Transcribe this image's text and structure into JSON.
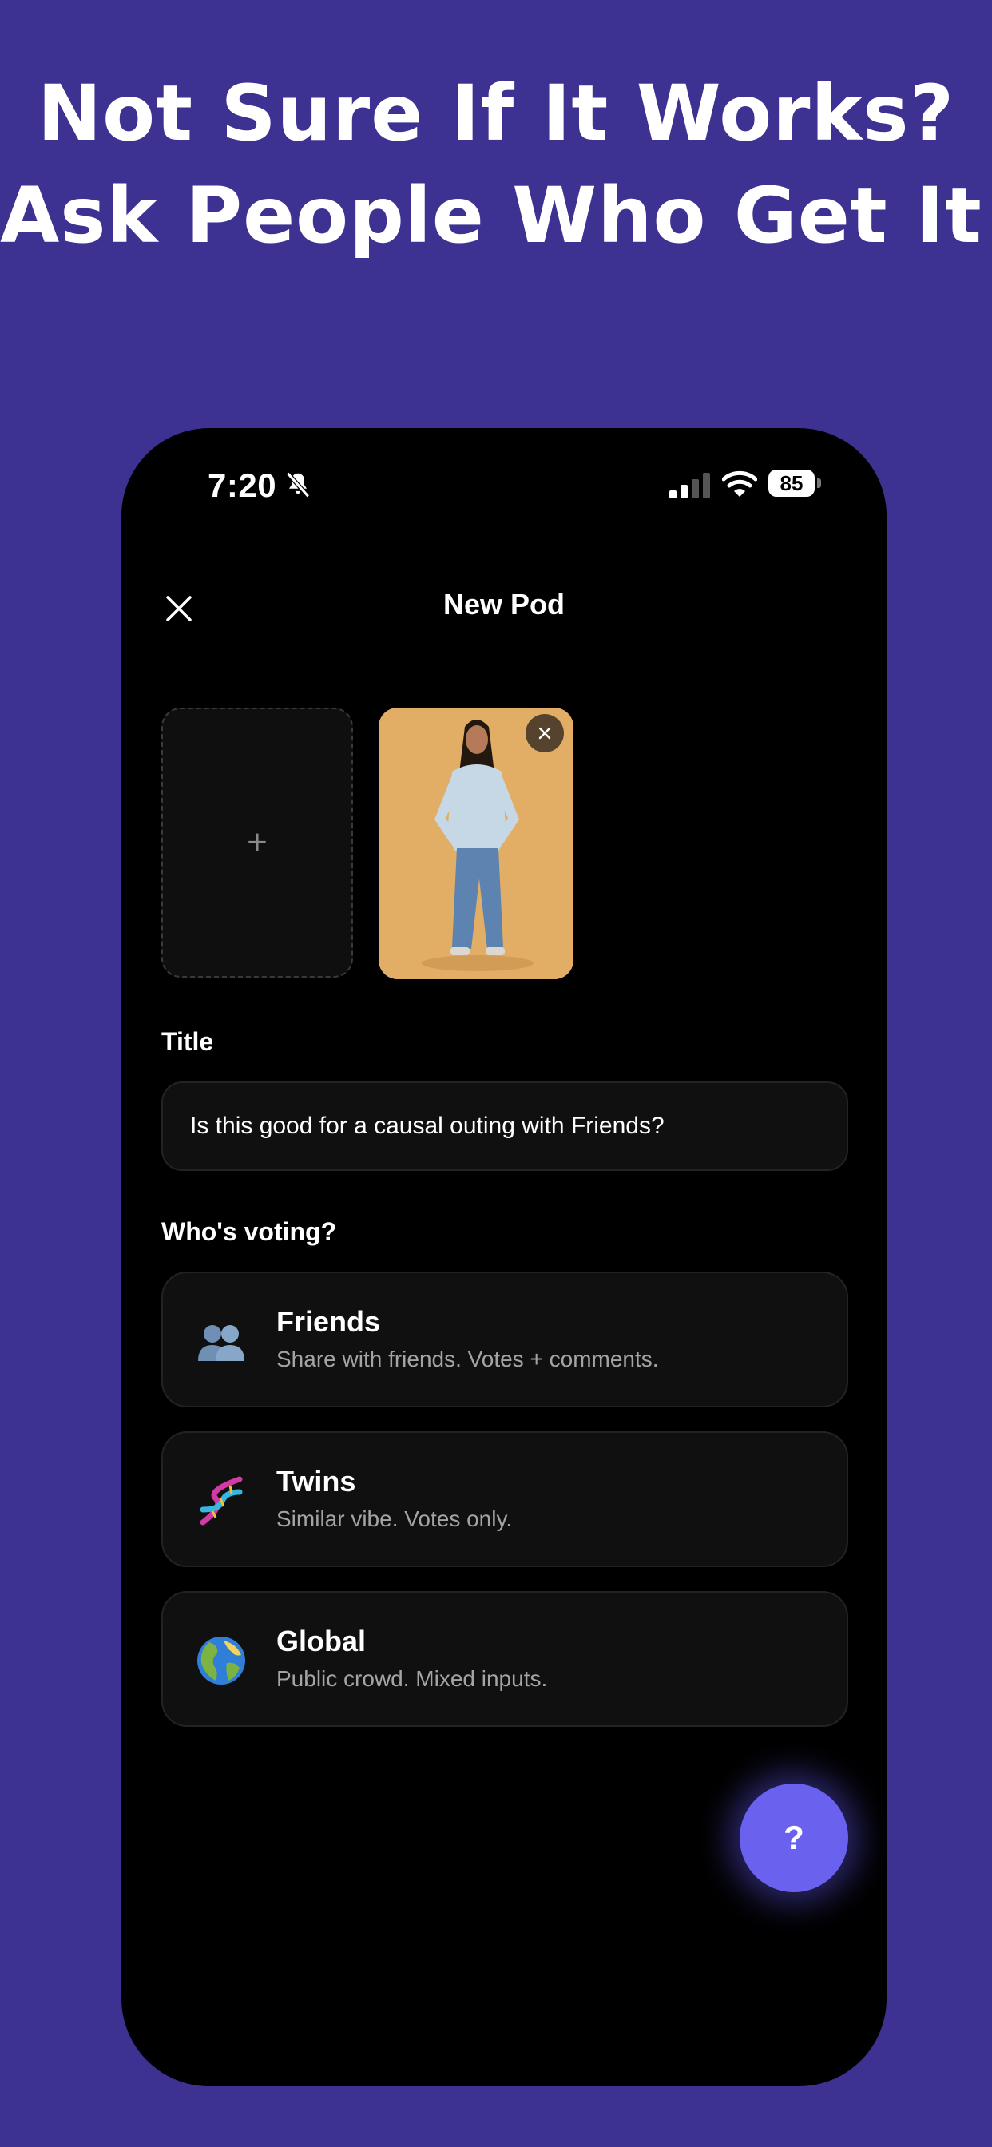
{
  "promo": {
    "headline_line1": "Not Sure If It Works?",
    "headline_line2": "Ask People Who Get It!"
  },
  "status_bar": {
    "time": "7:20",
    "battery": "85"
  },
  "nav": {
    "title": "New Pod"
  },
  "photos": {
    "add_label": "+"
  },
  "form": {
    "title_label": "Title",
    "title_value": "Is this good for a causal outing with Friends?",
    "voting_label": "Who's voting?"
  },
  "voting_options": [
    {
      "icon": "busts-in-silhouette-icon",
      "title": "Friends",
      "description": "Share with friends. Votes + comments."
    },
    {
      "icon": "dna-icon",
      "title": "Twins",
      "description": "Similar vibe. Votes only."
    },
    {
      "icon": "globe-icon",
      "title": "Global",
      "description": "Public crowd. Mixed inputs."
    }
  ],
  "help_button": {
    "label": "?"
  },
  "colors": {
    "background": "#3d3192",
    "phone": "#000000",
    "card": "#101010",
    "accent": "#6a61ef",
    "photo_bg": "#e2ad64"
  }
}
